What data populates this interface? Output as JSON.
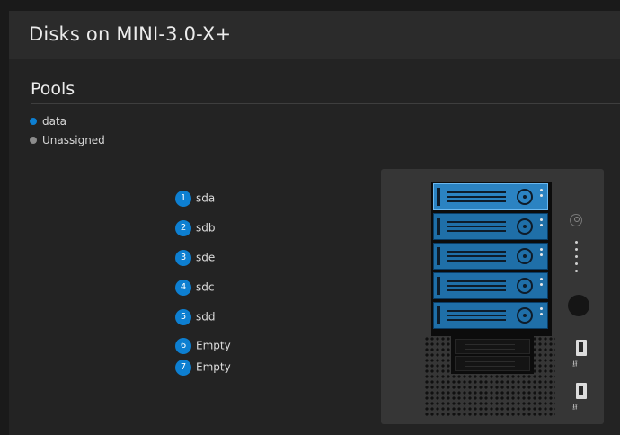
{
  "header": {
    "title": "Disks on MINI-3.0-X+"
  },
  "pools": {
    "title": "Pools",
    "legend": [
      {
        "label": "data",
        "color": "#0d7fd1"
      },
      {
        "label": "Unassigned",
        "color": "#8c8c8c"
      }
    ]
  },
  "disks": [
    {
      "num": "1",
      "label": "sda"
    },
    {
      "num": "2",
      "label": "sdb"
    },
    {
      "num": "3",
      "label": "sde"
    },
    {
      "num": "4",
      "label": "sdc"
    },
    {
      "num": "5",
      "label": "sdd"
    },
    {
      "num": "6",
      "label": "Empty"
    },
    {
      "num": "7",
      "label": "Empty"
    }
  ],
  "chassis": {
    "usb_symbol": "⭿"
  },
  "colors": {
    "accent": "#0d7fd1",
    "background": "#1a1a1a",
    "card": "#232323",
    "drive": "#1f6fa8"
  }
}
